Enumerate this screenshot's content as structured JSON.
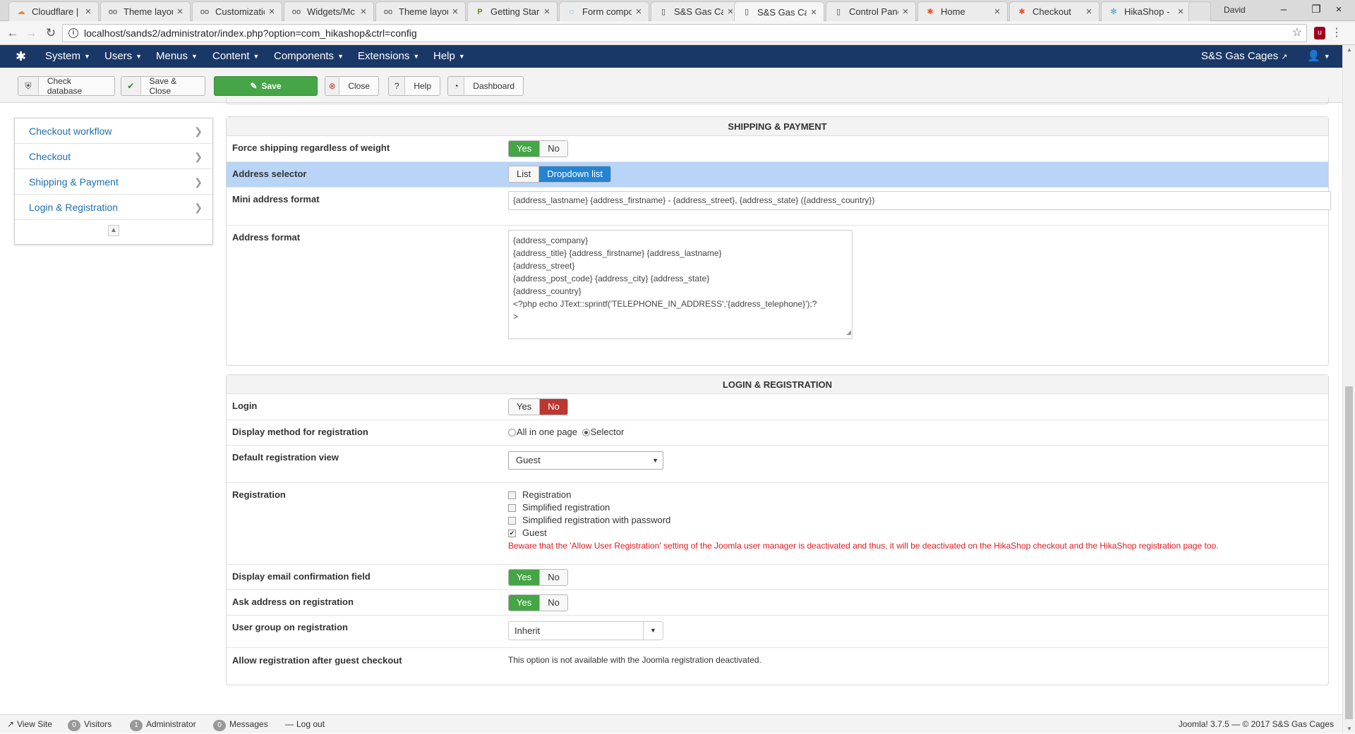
{
  "browser": {
    "tabs": [
      {
        "title": "Cloudflare |",
        "icon": "cloudflare-icon"
      },
      {
        "title": "Theme layou",
        "icon": "yoo-icon"
      },
      {
        "title": "Customizatic",
        "icon": "yoo-icon"
      },
      {
        "title": "Widgets/Mc",
        "icon": "yoo-icon"
      },
      {
        "title": "Theme layou",
        "icon": "yoo-icon"
      },
      {
        "title": "Getting Star",
        "icon": "p-icon"
      },
      {
        "title": "Form compo",
        "icon": "loading-icon"
      },
      {
        "title": "S&S Gas Cag",
        "icon": "page-icon"
      },
      {
        "title": "S&S Gas Cag",
        "icon": "page-icon"
      },
      {
        "title": "Control Pane",
        "icon": "page-icon"
      },
      {
        "title": "Home",
        "icon": "joomla-icon"
      },
      {
        "title": "Checkout",
        "icon": "joomla-icon"
      },
      {
        "title": "HikaShop - ",
        "icon": "hikashop-icon"
      }
    ],
    "user": "David",
    "url": "localhost/sands2/administrator/index.php?option=com_hikashop&ctrl=config"
  },
  "admin_nav": {
    "menus": [
      "System",
      "Users",
      "Menus",
      "Content",
      "Components",
      "Extensions",
      "Help"
    ],
    "site_name": "S&S Gas Cages"
  },
  "toolbar": {
    "check_database": "Check database",
    "save_close": "Save & Close",
    "save": "Save",
    "close": "Close",
    "help": "Help",
    "dashboard": "Dashboard"
  },
  "sidebar": {
    "items": [
      "Checkout workflow",
      "Checkout",
      "Shipping & Payment",
      "Login & Registration"
    ]
  },
  "shipping_payment": {
    "title": "SHIPPING & PAYMENT",
    "force_shipping": {
      "label": "Force shipping regardless of weight",
      "yes": "Yes",
      "no": "No",
      "value": "Yes"
    },
    "address_selector": {
      "label": "Address selector",
      "opt1": "List",
      "opt2": "Dropdown list",
      "value": "Dropdown list"
    },
    "mini_address_format": {
      "label": "Mini address format",
      "value": "{address_lastname} {address_firstname} - {address_street}, {address_state} ({address_country})"
    },
    "address_format": {
      "label": "Address format",
      "value": "{address_company}\n{address_title} {address_firstname} {address_lastname}\n{address_street}\n{address_post_code} {address_city} {address_state}\n{address_country}\n<?php echo JText::sprintf('TELEPHONE_IN_ADDRESS','{address_telephone}');?\n>"
    }
  },
  "login_registration": {
    "title": "LOGIN & REGISTRATION",
    "login": {
      "label": "Login",
      "yes": "Yes",
      "no": "No",
      "value": "No"
    },
    "display_method": {
      "label": "Display method for registration",
      "opt1": "All in one page",
      "opt2": "Selector",
      "value": "Selector"
    },
    "default_view": {
      "label": "Default registration view",
      "value": "Guest"
    },
    "registration": {
      "label": "Registration",
      "options": [
        {
          "label": "Registration",
          "checked": false
        },
        {
          "label": "Simplified registration",
          "checked": false
        },
        {
          "label": "Simplified registration with password",
          "checked": false
        },
        {
          "label": "Guest",
          "checked": true
        }
      ],
      "warning": "Beware that the 'Allow User Registration' setting of the Joomla user manager is deactivated and thus, it will be deactivated on the HikaShop checkout and the HikaShop registration page too."
    },
    "email_confirmation": {
      "label": "Display email confirmation field",
      "yes": "Yes",
      "no": "No",
      "value": "Yes"
    },
    "ask_address": {
      "label": "Ask address on registration",
      "yes": "Yes",
      "no": "No",
      "value": "Yes"
    },
    "user_group": {
      "label": "User group on registration",
      "value": "Inherit"
    },
    "allow_after_guest": {
      "label": "Allow registration after guest checkout",
      "value": "This option is not available with the Joomla registration deactivated."
    }
  },
  "status_bar": {
    "view_site": "View Site",
    "visitors_count": "0",
    "visitors": "Visitors",
    "admin_count": "1",
    "administrator": "Administrator",
    "messages_count": "0",
    "messages": "Messages",
    "logout": "Log out",
    "copyright": "Joomla! 3.7.5 — © 2017 S&S Gas Cages"
  }
}
